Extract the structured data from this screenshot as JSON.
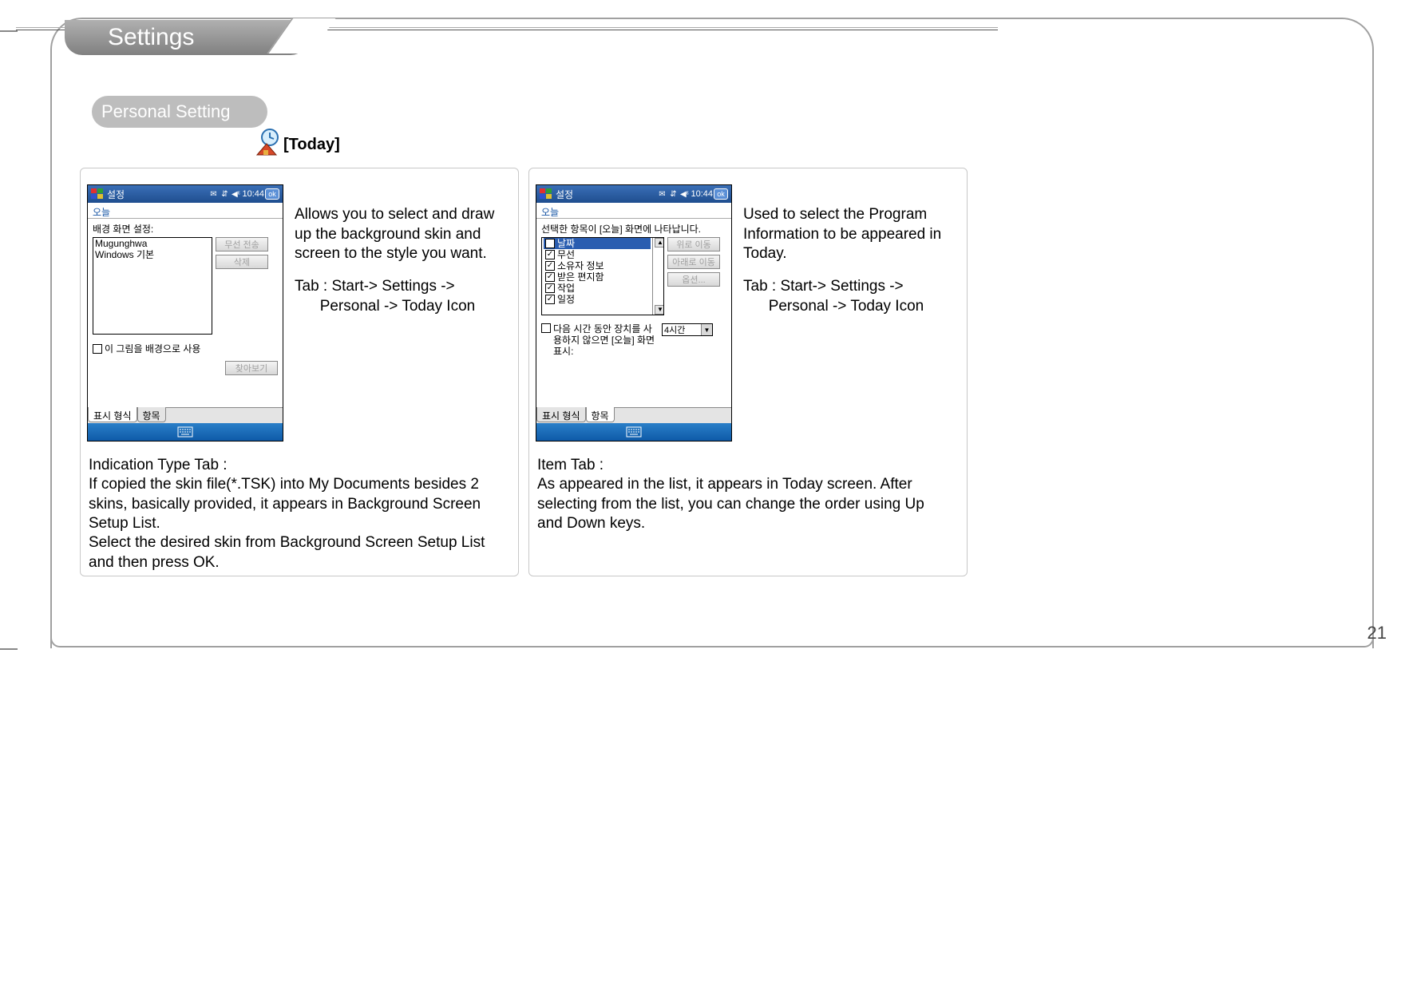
{
  "page": {
    "title": "Settings",
    "section": "Personal Setting",
    "topic": "[Today]",
    "number": "21"
  },
  "left": {
    "titlebar": {
      "app": "설정",
      "time": "10:44",
      "ok": "ok"
    },
    "subtitle": "오늘",
    "label_bg": "배경 화면 설정:",
    "skins": [
      "Mugunghwa",
      "Windows 기본"
    ],
    "btn_send": "무선 전송",
    "btn_delete": "삭제",
    "chk_usepic": "이 그림을 배경으로 사용",
    "btn_browse": "찾아보기",
    "tabs": [
      "표시 형식",
      "항목"
    ],
    "explain1": "Allows you to select and draw up the background skin and screen to the style you want.",
    "explain2a": "Tab : Start-> Settings ->",
    "explain2b": "Personal -> Today Icon",
    "below_title": "Indication Type Tab :",
    "below_body": "If copied the skin file(*.TSK) into My Documents besides 2 skins, basically provided, it appears in Background Screen Setup List.\nSelect the desired skin from Background Screen Setup List and then press OK."
  },
  "right": {
    "titlebar": {
      "app": "설정",
      "time": "10:44",
      "ok": "ok"
    },
    "subtitle": "오늘",
    "label_top": "선택한 항목이 [오늘] 화면에 나타납니다.",
    "items": [
      "날짜",
      "무선",
      "소유자 정보",
      "받은 편지함",
      "작업",
      "일정"
    ],
    "btn_up": "위로 이동",
    "btn_down": "아래로 이동",
    "btn_opt": "옵션...",
    "idle_label": "다음 시간 동안 장치를 사용하지 않으면 [오늘] 화면 표시:",
    "idle_value": "4시간",
    "tabs": [
      "표시 형식",
      "항목"
    ],
    "explain1": "Used to select the Program Information to be appeared in Today.",
    "explain2a": "Tab : Start-> Settings ->",
    "explain2b": "Personal -> Today Icon",
    "below_title": "Item Tab :",
    "below_body": "As appeared in the list, it appears in Today screen. After selecting from the list, you can change the order using Up and Down keys."
  }
}
